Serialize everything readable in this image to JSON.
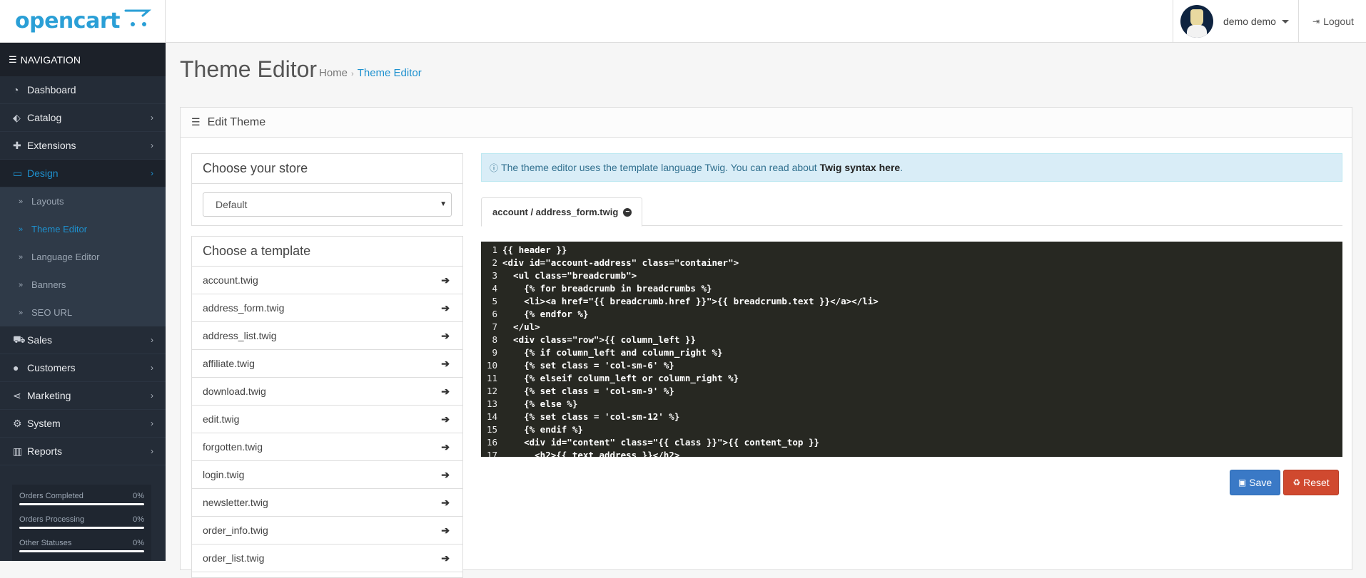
{
  "brand": {
    "logo_text": "opencart",
    "logo_cart": "·̇ ̇"
  },
  "header": {
    "user_name": "demo demo",
    "logout_label": "Logout"
  },
  "nav": {
    "heading": "NAVIGATION",
    "items": [
      {
        "label": "Dashboard",
        "icon": "dashboard-icon"
      },
      {
        "label": "Catalog",
        "icon": "tags-icon"
      },
      {
        "label": "Extensions",
        "icon": "puzzle-icon"
      },
      {
        "label": "Design",
        "icon": "monitor-icon"
      },
      {
        "label": "Sales",
        "icon": "cart-icon"
      },
      {
        "label": "Customers",
        "icon": "user-icon"
      },
      {
        "label": "Marketing",
        "icon": "share-icon"
      },
      {
        "label": "System",
        "icon": "gear-icon"
      },
      {
        "label": "Reports",
        "icon": "chart-icon"
      }
    ],
    "design_sub": [
      "Layouts",
      "Theme Editor",
      "Language Editor",
      "Banners",
      "SEO URL"
    ]
  },
  "stats": [
    {
      "label": "Orders Completed",
      "value": "0%",
      "fraction": 0
    },
    {
      "label": "Orders Processing",
      "value": "0%",
      "fraction": 0
    },
    {
      "label": "Other Statuses",
      "value": "0%",
      "fraction": 0
    }
  ],
  "page": {
    "title": "Theme Editor",
    "breadcrumb": [
      "Home",
      "Theme Editor"
    ],
    "panel_title": "Edit Theme"
  },
  "store": {
    "title": "Choose your store",
    "selected": "Default"
  },
  "templates": {
    "title": "Choose a template",
    "items": [
      "account.twig",
      "address_form.twig",
      "address_list.twig",
      "affiliate.twig",
      "download.twig",
      "edit.twig",
      "forgotten.twig",
      "login.twig",
      "newsletter.twig",
      "order_info.twig",
      "order_list.twig"
    ]
  },
  "info": {
    "text": "The theme editor uses the template language Twig. You can read about",
    "link": "Twig syntax here",
    "end": "."
  },
  "tab": {
    "label": "account / address_form.twig"
  },
  "code_lines": [
    "{{ header }}",
    "<div id=\"account-address\" class=\"container\">",
    "  <ul class=\"breadcrumb\">",
    "    {% for breadcrumb in breadcrumbs %}",
    "    <li><a href=\"{{ breadcrumb.href }}\">{{ breadcrumb.text }}</a></li>",
    "    {% endfor %}",
    "  </ul>",
    "  <div class=\"row\">{{ column_left }}",
    "    {% if column_left and column_right %}",
    "    {% set class = 'col-sm-6' %}",
    "    {% elseif column_left or column_right %}",
    "    {% set class = 'col-sm-9' %}",
    "    {% else %}",
    "    {% set class = 'col-sm-12' %}",
    "    {% endif %}",
    "    <div id=\"content\" class=\"{{ class }}\">{{ content_top }}",
    "      <h2>{{ text_address }}</h2>"
  ],
  "buttons": {
    "save": "Save",
    "reset": "Reset"
  }
}
